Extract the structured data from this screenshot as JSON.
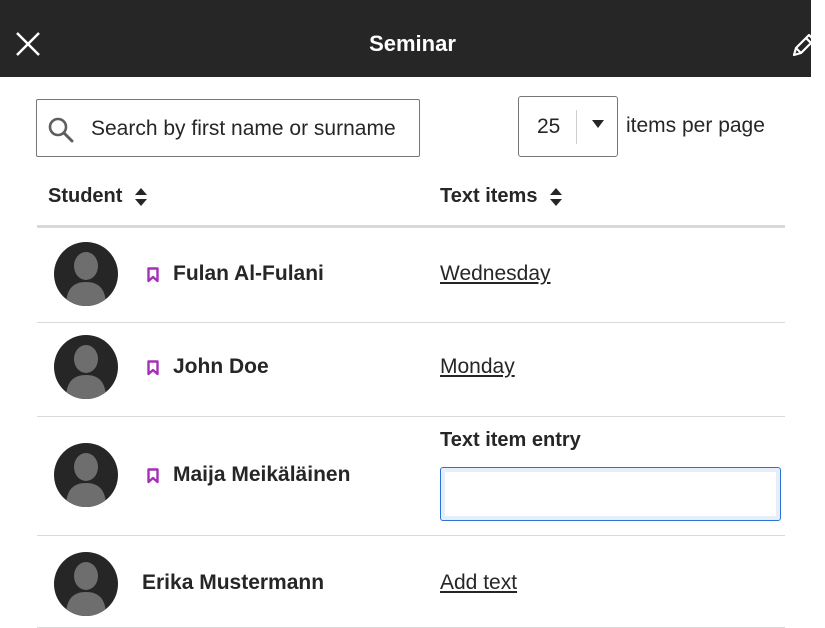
{
  "header": {
    "title": "Seminar",
    "close_icon": "close-icon",
    "edit_icon": "pencil-icon"
  },
  "search": {
    "placeholder": "Search by first name or surname",
    "value": "",
    "icon": "search-icon"
  },
  "pagination": {
    "per_page_value": "25",
    "per_page_label": "items per page"
  },
  "table": {
    "columns": [
      {
        "label": "Student",
        "sortable": true
      },
      {
        "label": "Text items",
        "sortable": true
      }
    ],
    "rows": [
      {
        "name": "Fulan Al-Fulani",
        "flagged": true,
        "text": "Wednesday"
      },
      {
        "name": "John Doe",
        "flagged": true,
        "text": "Monday"
      },
      {
        "name": "Maija Meikäläinen",
        "flagged": true,
        "entry_label": "Text item entry",
        "entry_value": ""
      },
      {
        "name": "Erika Mustermann",
        "flagged": false,
        "text": "Add text"
      }
    ]
  },
  "colors": {
    "header_bg": "#262626",
    "flag": "#a62fb9",
    "focus": "#2a74d6"
  }
}
